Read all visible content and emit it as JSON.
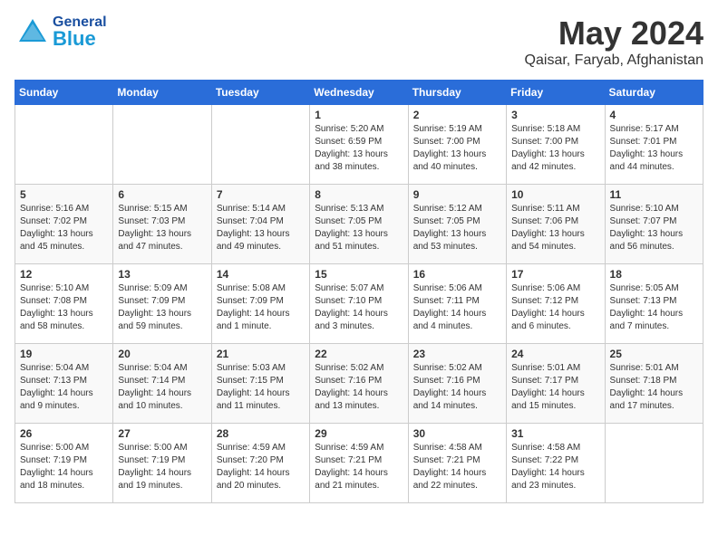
{
  "header": {
    "logo_line1": "General",
    "logo_line2": "Blue",
    "month": "May 2024",
    "location": "Qaisar, Faryab, Afghanistan"
  },
  "weekdays": [
    "Sunday",
    "Monday",
    "Tuesday",
    "Wednesday",
    "Thursday",
    "Friday",
    "Saturday"
  ],
  "weeks": [
    [
      {
        "day": "",
        "info": ""
      },
      {
        "day": "",
        "info": ""
      },
      {
        "day": "",
        "info": ""
      },
      {
        "day": "1",
        "info": "Sunrise: 5:20 AM\nSunset: 6:59 PM\nDaylight: 13 hours\nand 38 minutes."
      },
      {
        "day": "2",
        "info": "Sunrise: 5:19 AM\nSunset: 7:00 PM\nDaylight: 13 hours\nand 40 minutes."
      },
      {
        "day": "3",
        "info": "Sunrise: 5:18 AM\nSunset: 7:00 PM\nDaylight: 13 hours\nand 42 minutes."
      },
      {
        "day": "4",
        "info": "Sunrise: 5:17 AM\nSunset: 7:01 PM\nDaylight: 13 hours\nand 44 minutes."
      }
    ],
    [
      {
        "day": "5",
        "info": "Sunrise: 5:16 AM\nSunset: 7:02 PM\nDaylight: 13 hours\nand 45 minutes."
      },
      {
        "day": "6",
        "info": "Sunrise: 5:15 AM\nSunset: 7:03 PM\nDaylight: 13 hours\nand 47 minutes."
      },
      {
        "day": "7",
        "info": "Sunrise: 5:14 AM\nSunset: 7:04 PM\nDaylight: 13 hours\nand 49 minutes."
      },
      {
        "day": "8",
        "info": "Sunrise: 5:13 AM\nSunset: 7:05 PM\nDaylight: 13 hours\nand 51 minutes."
      },
      {
        "day": "9",
        "info": "Sunrise: 5:12 AM\nSunset: 7:05 PM\nDaylight: 13 hours\nand 53 minutes."
      },
      {
        "day": "10",
        "info": "Sunrise: 5:11 AM\nSunset: 7:06 PM\nDaylight: 13 hours\nand 54 minutes."
      },
      {
        "day": "11",
        "info": "Sunrise: 5:10 AM\nSunset: 7:07 PM\nDaylight: 13 hours\nand 56 minutes."
      }
    ],
    [
      {
        "day": "12",
        "info": "Sunrise: 5:10 AM\nSunset: 7:08 PM\nDaylight: 13 hours\nand 58 minutes."
      },
      {
        "day": "13",
        "info": "Sunrise: 5:09 AM\nSunset: 7:09 PM\nDaylight: 13 hours\nand 59 minutes."
      },
      {
        "day": "14",
        "info": "Sunrise: 5:08 AM\nSunset: 7:09 PM\nDaylight: 14 hours\nand 1 minute."
      },
      {
        "day": "15",
        "info": "Sunrise: 5:07 AM\nSunset: 7:10 PM\nDaylight: 14 hours\nand 3 minutes."
      },
      {
        "day": "16",
        "info": "Sunrise: 5:06 AM\nSunset: 7:11 PM\nDaylight: 14 hours\nand 4 minutes."
      },
      {
        "day": "17",
        "info": "Sunrise: 5:06 AM\nSunset: 7:12 PM\nDaylight: 14 hours\nand 6 minutes."
      },
      {
        "day": "18",
        "info": "Sunrise: 5:05 AM\nSunset: 7:13 PM\nDaylight: 14 hours\nand 7 minutes."
      }
    ],
    [
      {
        "day": "19",
        "info": "Sunrise: 5:04 AM\nSunset: 7:13 PM\nDaylight: 14 hours\nand 9 minutes."
      },
      {
        "day": "20",
        "info": "Sunrise: 5:04 AM\nSunset: 7:14 PM\nDaylight: 14 hours\nand 10 minutes."
      },
      {
        "day": "21",
        "info": "Sunrise: 5:03 AM\nSunset: 7:15 PM\nDaylight: 14 hours\nand 11 minutes."
      },
      {
        "day": "22",
        "info": "Sunrise: 5:02 AM\nSunset: 7:16 PM\nDaylight: 14 hours\nand 13 minutes."
      },
      {
        "day": "23",
        "info": "Sunrise: 5:02 AM\nSunset: 7:16 PM\nDaylight: 14 hours\nand 14 minutes."
      },
      {
        "day": "24",
        "info": "Sunrise: 5:01 AM\nSunset: 7:17 PM\nDaylight: 14 hours\nand 15 minutes."
      },
      {
        "day": "25",
        "info": "Sunrise: 5:01 AM\nSunset: 7:18 PM\nDaylight: 14 hours\nand 17 minutes."
      }
    ],
    [
      {
        "day": "26",
        "info": "Sunrise: 5:00 AM\nSunset: 7:19 PM\nDaylight: 14 hours\nand 18 minutes."
      },
      {
        "day": "27",
        "info": "Sunrise: 5:00 AM\nSunset: 7:19 PM\nDaylight: 14 hours\nand 19 minutes."
      },
      {
        "day": "28",
        "info": "Sunrise: 4:59 AM\nSunset: 7:20 PM\nDaylight: 14 hours\nand 20 minutes."
      },
      {
        "day": "29",
        "info": "Sunrise: 4:59 AM\nSunset: 7:21 PM\nDaylight: 14 hours\nand 21 minutes."
      },
      {
        "day": "30",
        "info": "Sunrise: 4:58 AM\nSunset: 7:21 PM\nDaylight: 14 hours\nand 22 minutes."
      },
      {
        "day": "31",
        "info": "Sunrise: 4:58 AM\nSunset: 7:22 PM\nDaylight: 14 hours\nand 23 minutes."
      },
      {
        "day": "",
        "info": ""
      }
    ]
  ]
}
